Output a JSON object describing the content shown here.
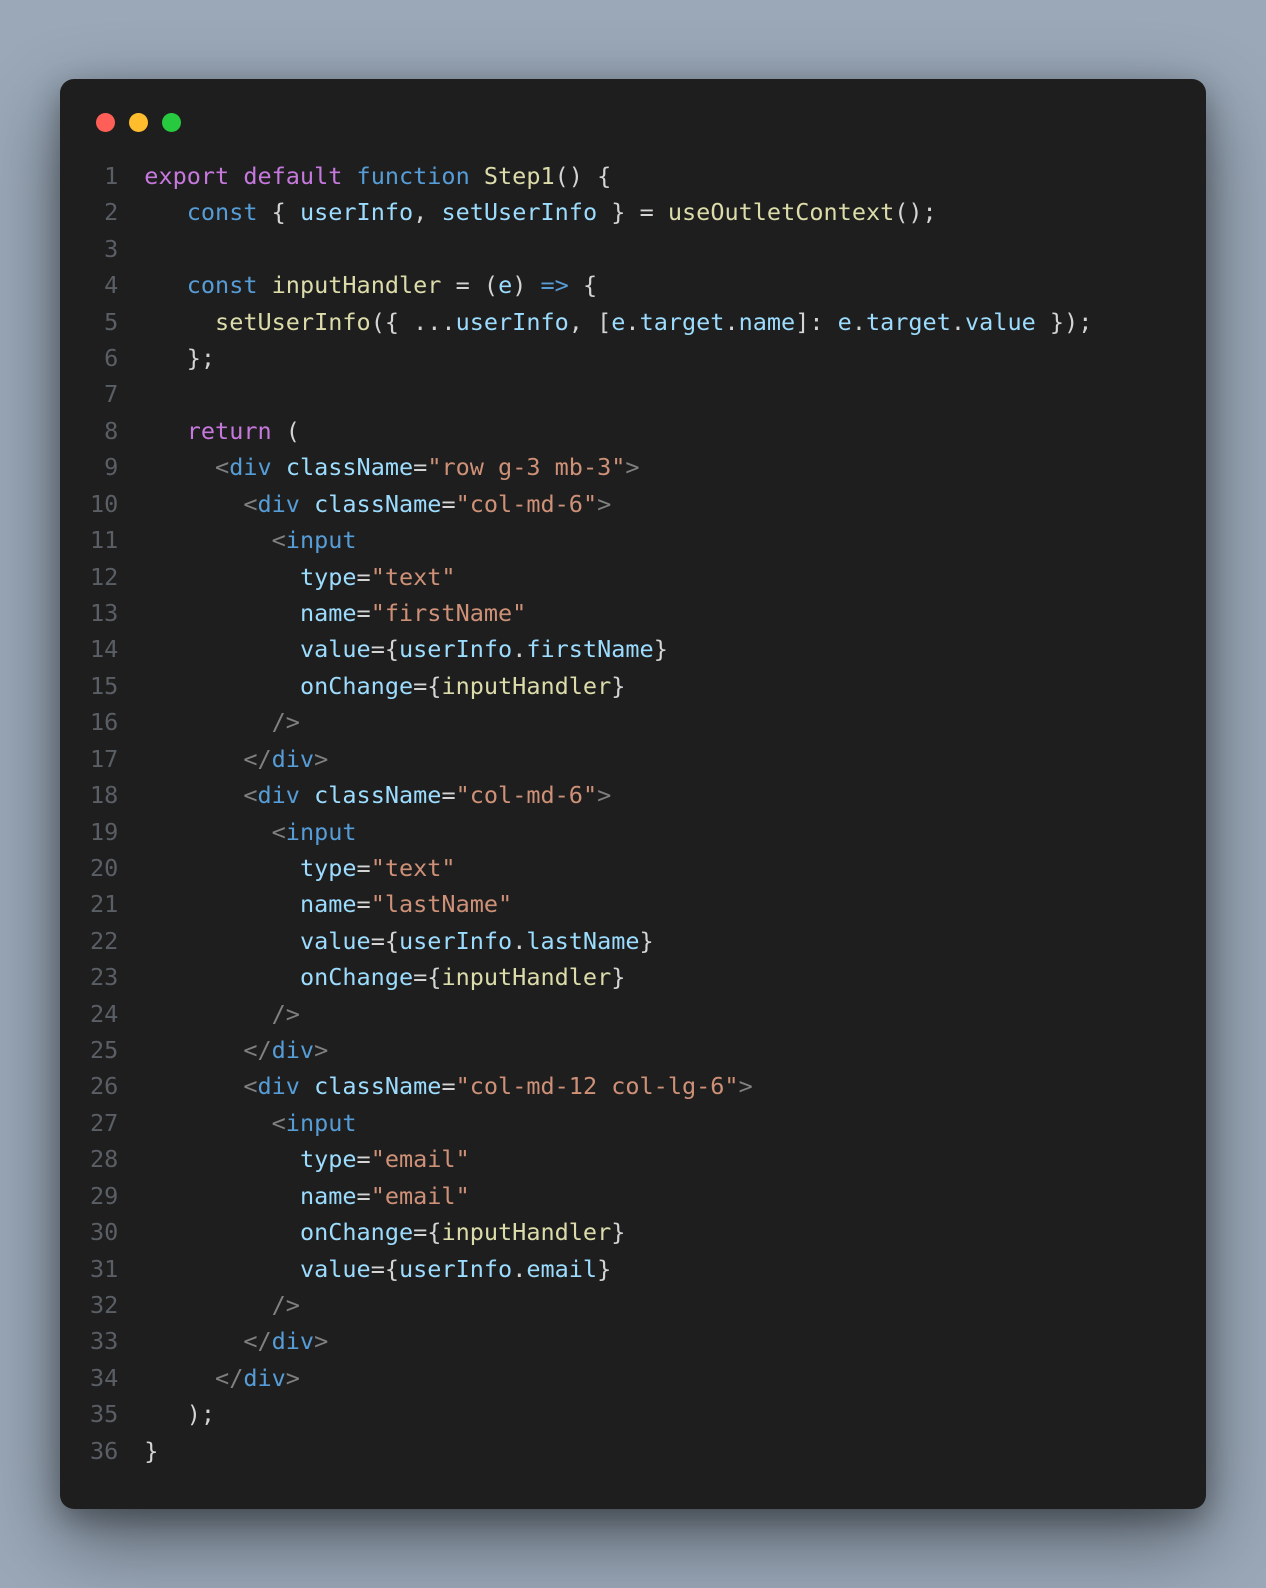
{
  "window": {
    "buttons": [
      "close",
      "minimize",
      "zoom"
    ]
  },
  "code": {
    "language": "jsx",
    "lineNumbers": [
      "1",
      "2",
      "3",
      "4",
      "5",
      "6",
      "7",
      "8",
      "9",
      "10",
      "11",
      "12",
      "13",
      "14",
      "15",
      "16",
      "17",
      "18",
      "19",
      "20",
      "21",
      "22",
      "23",
      "24",
      "25",
      "26",
      "27",
      "28",
      "29",
      "30",
      "31",
      "32",
      "33",
      "34",
      "35",
      "36"
    ],
    "lines": [
      [
        [
          "kw",
          "export"
        ],
        [
          "sp",
          " "
        ],
        [
          "kw",
          "default"
        ],
        [
          "sp",
          " "
        ],
        [
          "kw2",
          "function"
        ],
        [
          "sp",
          " "
        ],
        [
          "fn",
          "Step1"
        ],
        [
          "punc",
          "()"
        ],
        [
          "sp",
          " "
        ],
        [
          "punc",
          "{"
        ]
      ],
      [
        [
          "sp",
          "   "
        ],
        [
          "kw2",
          "const"
        ],
        [
          "sp",
          " "
        ],
        [
          "punc",
          "{"
        ],
        [
          "sp",
          " "
        ],
        [
          "prop",
          "userInfo"
        ],
        [
          "punc",
          ","
        ],
        [
          "sp",
          " "
        ],
        [
          "prop",
          "setUserInfo"
        ],
        [
          "sp",
          " "
        ],
        [
          "punc",
          "}"
        ],
        [
          "sp",
          " "
        ],
        [
          "punc",
          "="
        ],
        [
          "sp",
          " "
        ],
        [
          "fn",
          "useOutletContext"
        ],
        [
          "punc",
          "();"
        ]
      ],
      [],
      [
        [
          "sp",
          "   "
        ],
        [
          "kw2",
          "const"
        ],
        [
          "sp",
          " "
        ],
        [
          "fn",
          "inputHandler"
        ],
        [
          "sp",
          " "
        ],
        [
          "punc",
          "="
        ],
        [
          "sp",
          " "
        ],
        [
          "punc",
          "("
        ],
        [
          "prop",
          "e"
        ],
        [
          "punc",
          ")"
        ],
        [
          "sp",
          " "
        ],
        [
          "kw2",
          "=>"
        ],
        [
          "sp",
          " "
        ],
        [
          "punc",
          "{"
        ]
      ],
      [
        [
          "sp",
          "     "
        ],
        [
          "fn",
          "setUserInfo"
        ],
        [
          "punc",
          "({"
        ],
        [
          "sp",
          " "
        ],
        [
          "punc",
          "..."
        ],
        [
          "prop",
          "userInfo"
        ],
        [
          "punc",
          ","
        ],
        [
          "sp",
          " "
        ],
        [
          "punc",
          "["
        ],
        [
          "prop",
          "e"
        ],
        [
          "punc",
          "."
        ],
        [
          "prop",
          "target"
        ],
        [
          "punc",
          "."
        ],
        [
          "prop",
          "name"
        ],
        [
          "punc",
          "]:"
        ],
        [
          "sp",
          " "
        ],
        [
          "prop",
          "e"
        ],
        [
          "punc",
          "."
        ],
        [
          "prop",
          "target"
        ],
        [
          "punc",
          "."
        ],
        [
          "prop",
          "value"
        ],
        [
          "sp",
          " "
        ],
        [
          "punc",
          "});"
        ]
      ],
      [
        [
          "sp",
          "   "
        ],
        [
          "punc",
          "};"
        ]
      ],
      [],
      [
        [
          "sp",
          "   "
        ],
        [
          "kw",
          "return"
        ],
        [
          "sp",
          " "
        ],
        [
          "punc",
          "("
        ]
      ],
      [
        [
          "sp",
          "     "
        ],
        [
          "tagp",
          "<"
        ],
        [
          "tag",
          "div"
        ],
        [
          "sp",
          " "
        ],
        [
          "attr",
          "className"
        ],
        [
          "punc",
          "="
        ],
        [
          "str",
          "\"row g-3 mb-3\""
        ],
        [
          "tagp",
          ">"
        ]
      ],
      [
        [
          "sp",
          "       "
        ],
        [
          "tagp",
          "<"
        ],
        [
          "tag",
          "div"
        ],
        [
          "sp",
          " "
        ],
        [
          "attr",
          "className"
        ],
        [
          "punc",
          "="
        ],
        [
          "str",
          "\"col-md-6\""
        ],
        [
          "tagp",
          ">"
        ]
      ],
      [
        [
          "sp",
          "         "
        ],
        [
          "tagp",
          "<"
        ],
        [
          "tag",
          "input"
        ]
      ],
      [
        [
          "sp",
          "           "
        ],
        [
          "attr",
          "type"
        ],
        [
          "punc",
          "="
        ],
        [
          "str",
          "\"text\""
        ]
      ],
      [
        [
          "sp",
          "           "
        ],
        [
          "attr",
          "name"
        ],
        [
          "punc",
          "="
        ],
        [
          "str",
          "\"firstName\""
        ]
      ],
      [
        [
          "sp",
          "           "
        ],
        [
          "attr",
          "value"
        ],
        [
          "punc",
          "="
        ],
        [
          "jsx",
          "{"
        ],
        [
          "prop",
          "userInfo"
        ],
        [
          "punc",
          "."
        ],
        [
          "prop",
          "firstName"
        ],
        [
          "jsx",
          "}"
        ]
      ],
      [
        [
          "sp",
          "           "
        ],
        [
          "attr",
          "onChange"
        ],
        [
          "punc",
          "="
        ],
        [
          "jsx",
          "{"
        ],
        [
          "fn",
          "inputHandler"
        ],
        [
          "jsx",
          "}"
        ]
      ],
      [
        [
          "sp",
          "         "
        ],
        [
          "tagp",
          "/>"
        ]
      ],
      [
        [
          "sp",
          "       "
        ],
        [
          "tagp",
          "</"
        ],
        [
          "tag",
          "div"
        ],
        [
          "tagp",
          ">"
        ]
      ],
      [
        [
          "sp",
          "       "
        ],
        [
          "tagp",
          "<"
        ],
        [
          "tag",
          "div"
        ],
        [
          "sp",
          " "
        ],
        [
          "attr",
          "className"
        ],
        [
          "punc",
          "="
        ],
        [
          "str",
          "\"col-md-6\""
        ],
        [
          "tagp",
          ">"
        ]
      ],
      [
        [
          "sp",
          "         "
        ],
        [
          "tagp",
          "<"
        ],
        [
          "tag",
          "input"
        ]
      ],
      [
        [
          "sp",
          "           "
        ],
        [
          "attr",
          "type"
        ],
        [
          "punc",
          "="
        ],
        [
          "str",
          "\"text\""
        ]
      ],
      [
        [
          "sp",
          "           "
        ],
        [
          "attr",
          "name"
        ],
        [
          "punc",
          "="
        ],
        [
          "str",
          "\"lastName\""
        ]
      ],
      [
        [
          "sp",
          "           "
        ],
        [
          "attr",
          "value"
        ],
        [
          "punc",
          "="
        ],
        [
          "jsx",
          "{"
        ],
        [
          "prop",
          "userInfo"
        ],
        [
          "punc",
          "."
        ],
        [
          "prop",
          "lastName"
        ],
        [
          "jsx",
          "}"
        ]
      ],
      [
        [
          "sp",
          "           "
        ],
        [
          "attr",
          "onChange"
        ],
        [
          "punc",
          "="
        ],
        [
          "jsx",
          "{"
        ],
        [
          "fn",
          "inputHandler"
        ],
        [
          "jsx",
          "}"
        ]
      ],
      [
        [
          "sp",
          "         "
        ],
        [
          "tagp",
          "/>"
        ]
      ],
      [
        [
          "sp",
          "       "
        ],
        [
          "tagp",
          "</"
        ],
        [
          "tag",
          "div"
        ],
        [
          "tagp",
          ">"
        ]
      ],
      [
        [
          "sp",
          "       "
        ],
        [
          "tagp",
          "<"
        ],
        [
          "tag",
          "div"
        ],
        [
          "sp",
          " "
        ],
        [
          "attr",
          "className"
        ],
        [
          "punc",
          "="
        ],
        [
          "str",
          "\"col-md-12 col-lg-6\""
        ],
        [
          "tagp",
          ">"
        ]
      ],
      [
        [
          "sp",
          "         "
        ],
        [
          "tagp",
          "<"
        ],
        [
          "tag",
          "input"
        ]
      ],
      [
        [
          "sp",
          "           "
        ],
        [
          "attr",
          "type"
        ],
        [
          "punc",
          "="
        ],
        [
          "str",
          "\"email\""
        ]
      ],
      [
        [
          "sp",
          "           "
        ],
        [
          "attr",
          "name"
        ],
        [
          "punc",
          "="
        ],
        [
          "str",
          "\"email\""
        ]
      ],
      [
        [
          "sp",
          "           "
        ],
        [
          "attr",
          "onChange"
        ],
        [
          "punc",
          "="
        ],
        [
          "jsx",
          "{"
        ],
        [
          "fn",
          "inputHandler"
        ],
        [
          "jsx",
          "}"
        ]
      ],
      [
        [
          "sp",
          "           "
        ],
        [
          "attr",
          "value"
        ],
        [
          "punc",
          "="
        ],
        [
          "jsx",
          "{"
        ],
        [
          "prop",
          "userInfo"
        ],
        [
          "punc",
          "."
        ],
        [
          "prop",
          "email"
        ],
        [
          "jsx",
          "}"
        ]
      ],
      [
        [
          "sp",
          "         "
        ],
        [
          "tagp",
          "/>"
        ]
      ],
      [
        [
          "sp",
          "       "
        ],
        [
          "tagp",
          "</"
        ],
        [
          "tag",
          "div"
        ],
        [
          "tagp",
          ">"
        ]
      ],
      [
        [
          "sp",
          "     "
        ],
        [
          "tagp",
          "</"
        ],
        [
          "tag",
          "div"
        ],
        [
          "tagp",
          ">"
        ]
      ],
      [
        [
          "sp",
          "   "
        ],
        [
          "punc",
          ");"
        ]
      ],
      [
        [
          "punc",
          "}"
        ]
      ]
    ]
  }
}
